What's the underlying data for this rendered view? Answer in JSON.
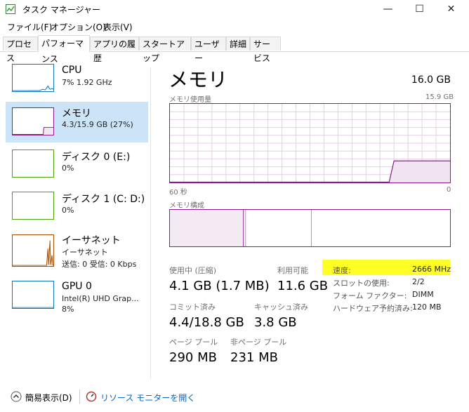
{
  "window": {
    "title": "タスク マネージャー",
    "minimize": "—",
    "maximize": "☐",
    "close": "✕"
  },
  "menu": [
    "ファイル(F)",
    "オプション(O)",
    "表示(V)"
  ],
  "tabs": [
    "プロセス",
    "パフォーマンス",
    "アプリの履歴",
    "スタートアップ",
    "ユーザー",
    "詳細",
    "サービス"
  ],
  "active_tab": "パフォーマンス",
  "resources": [
    {
      "name": "CPU",
      "line1": "7%  1.92 GHz",
      "line2": "",
      "color": "#1175bd"
    },
    {
      "name": "メモリ",
      "line1": "4.3/15.9 GB (27%)",
      "line2": "",
      "color": "#8b1a8b"
    },
    {
      "name": "ディスク 0 (E:)",
      "line1": "0%",
      "line2": "",
      "color": "#4da60c"
    },
    {
      "name": "ディスク 1 (C: D:)",
      "line1": "0%",
      "line2": "",
      "color": "#4da60c"
    },
    {
      "name": "イーサネット",
      "line1": "イーサネット",
      "line2": "送信: 0 受信: 0 Kbps",
      "color": "#a74f01"
    },
    {
      "name": "GPU 0",
      "line1": "Intel(R) UHD Grap...",
      "line2": "8%",
      "color": "#1175bd"
    }
  ],
  "memory": {
    "title": "メモリ",
    "total": "16.0 GB",
    "usage_label": "メモリ使用量",
    "usage_max": "15.9 GB",
    "time_left": "60 秒",
    "time_right": "0",
    "composition_label": "メモリ構成",
    "in_use_label": "使用中 (圧縮)",
    "in_use_value": "4.1 GB (1.7 MB)",
    "available_label": "利用可能",
    "available_value": "11.6 GB",
    "committed_label": "コミット済み",
    "committed_value": "4.4/18.8 GB",
    "cached_label": "キャッシュ済み",
    "cached_value": "3.8 GB",
    "paged_label": "ページ プール",
    "paged_value": "290 MB",
    "nonpaged_label": "非ページ プール",
    "nonpaged_value": "231 MB",
    "speed_label": "速度:",
    "speed_value": "2666 MHz",
    "slots_label": "スロットの使用:",
    "slots_value": "2/2",
    "form_label": "フォーム ファクター:",
    "form_value": "DIMM",
    "reserved_label": "ハードウェア予約済み:",
    "reserved_value": "120 MB",
    "usage_fraction": 0.27,
    "highlight_color": "#ffff26"
  },
  "footer": {
    "fewer_details": "簡易表示(D)",
    "resource_monitor": "リソース モニターを開く"
  },
  "colors": {
    "memory_accent": "#8b1a8b",
    "selection": "#cce4f7",
    "link": "#0066cc"
  }
}
